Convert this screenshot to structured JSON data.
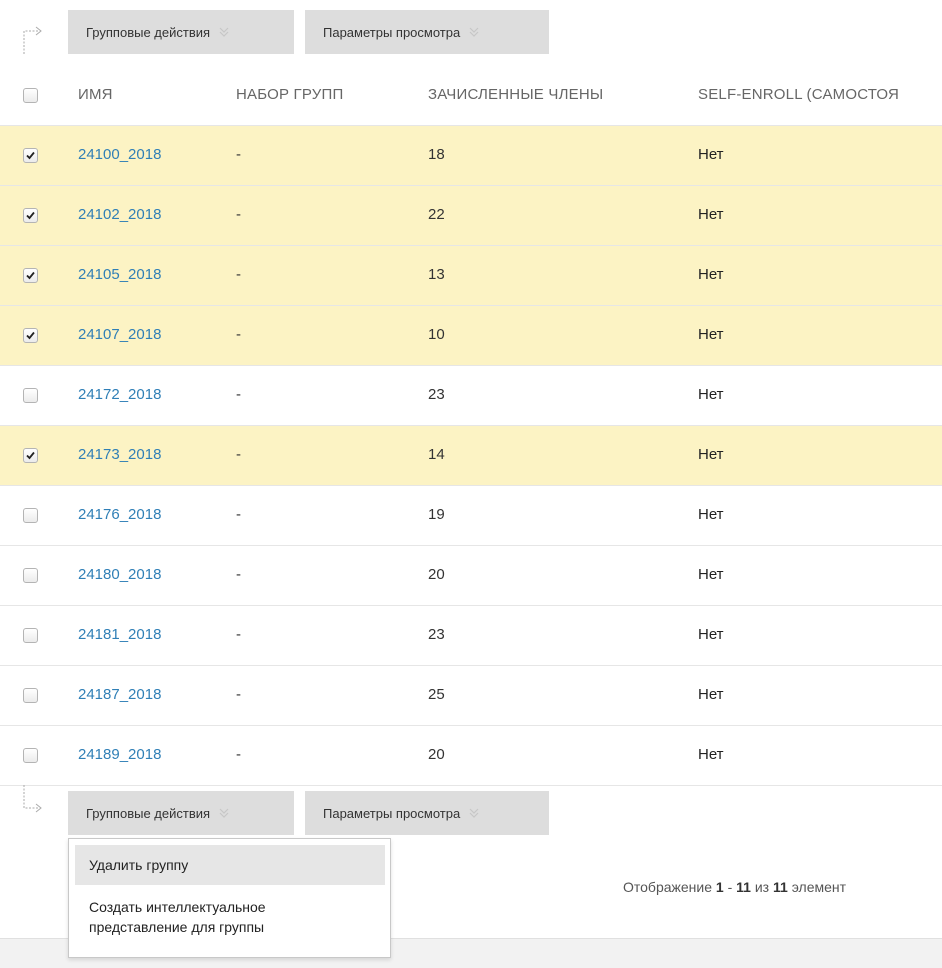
{
  "toolbar": {
    "actions_label": "Групповые действия",
    "view_label": "Параметры просмотра"
  },
  "table": {
    "headers": {
      "name": "ИМЯ",
      "group_set": "НАБОР ГРУПП",
      "enrolled": "ЗАЧИСЛЕННЫЕ ЧЛЕНЫ",
      "self_enroll": "SELF-ENROLL (САМОСТОЯ"
    },
    "rows": [
      {
        "name": "24100_2018",
        "group_set": "-",
        "enrolled": "18",
        "self_enroll": "Нет",
        "checked": true
      },
      {
        "name": "24102_2018",
        "group_set": "-",
        "enrolled": "22",
        "self_enroll": "Нет",
        "checked": true
      },
      {
        "name": "24105_2018",
        "group_set": "-",
        "enrolled": "13",
        "self_enroll": "Нет",
        "checked": true
      },
      {
        "name": "24107_2018",
        "group_set": "-",
        "enrolled": "10",
        "self_enroll": "Нет",
        "checked": true
      },
      {
        "name": "24172_2018",
        "group_set": "-",
        "enrolled": "23",
        "self_enroll": "Нет",
        "checked": false
      },
      {
        "name": "24173_2018",
        "group_set": "-",
        "enrolled": "14",
        "self_enroll": "Нет",
        "checked": true
      },
      {
        "name": "24176_2018",
        "group_set": "-",
        "enrolled": "19",
        "self_enroll": "Нет",
        "checked": false
      },
      {
        "name": "24180_2018",
        "group_set": "-",
        "enrolled": "20",
        "self_enroll": "Нет",
        "checked": false
      },
      {
        "name": "24181_2018",
        "group_set": "-",
        "enrolled": "23",
        "self_enroll": "Нет",
        "checked": false
      },
      {
        "name": "24187_2018",
        "group_set": "-",
        "enrolled": "25",
        "self_enroll": "Нет",
        "checked": false
      },
      {
        "name": "24189_2018",
        "group_set": "-",
        "enrolled": "20",
        "self_enroll": "Нет",
        "checked": false
      }
    ]
  },
  "dropdown": {
    "items": [
      "Удалить группу",
      "Создать интеллектуальное представление для группы"
    ]
  },
  "paging": {
    "prefix": "Отображение",
    "from": "1",
    "dash": "-",
    "to": "11",
    "of": "из",
    "total": "11",
    "suffix": "элемент"
  },
  "colors": {
    "link": "#2f7fb6",
    "selected_row": "#fcf3c4",
    "button_bg": "#dddddd"
  },
  "icons": {
    "toolbar_arrow_top": "corner-arrow-down-right-icon",
    "toolbar_arrow_bottom": "corner-arrow-up-right-icon",
    "button_chevron": "double-chevron-down-icon",
    "checkbox_check": "checkmark-icon"
  }
}
